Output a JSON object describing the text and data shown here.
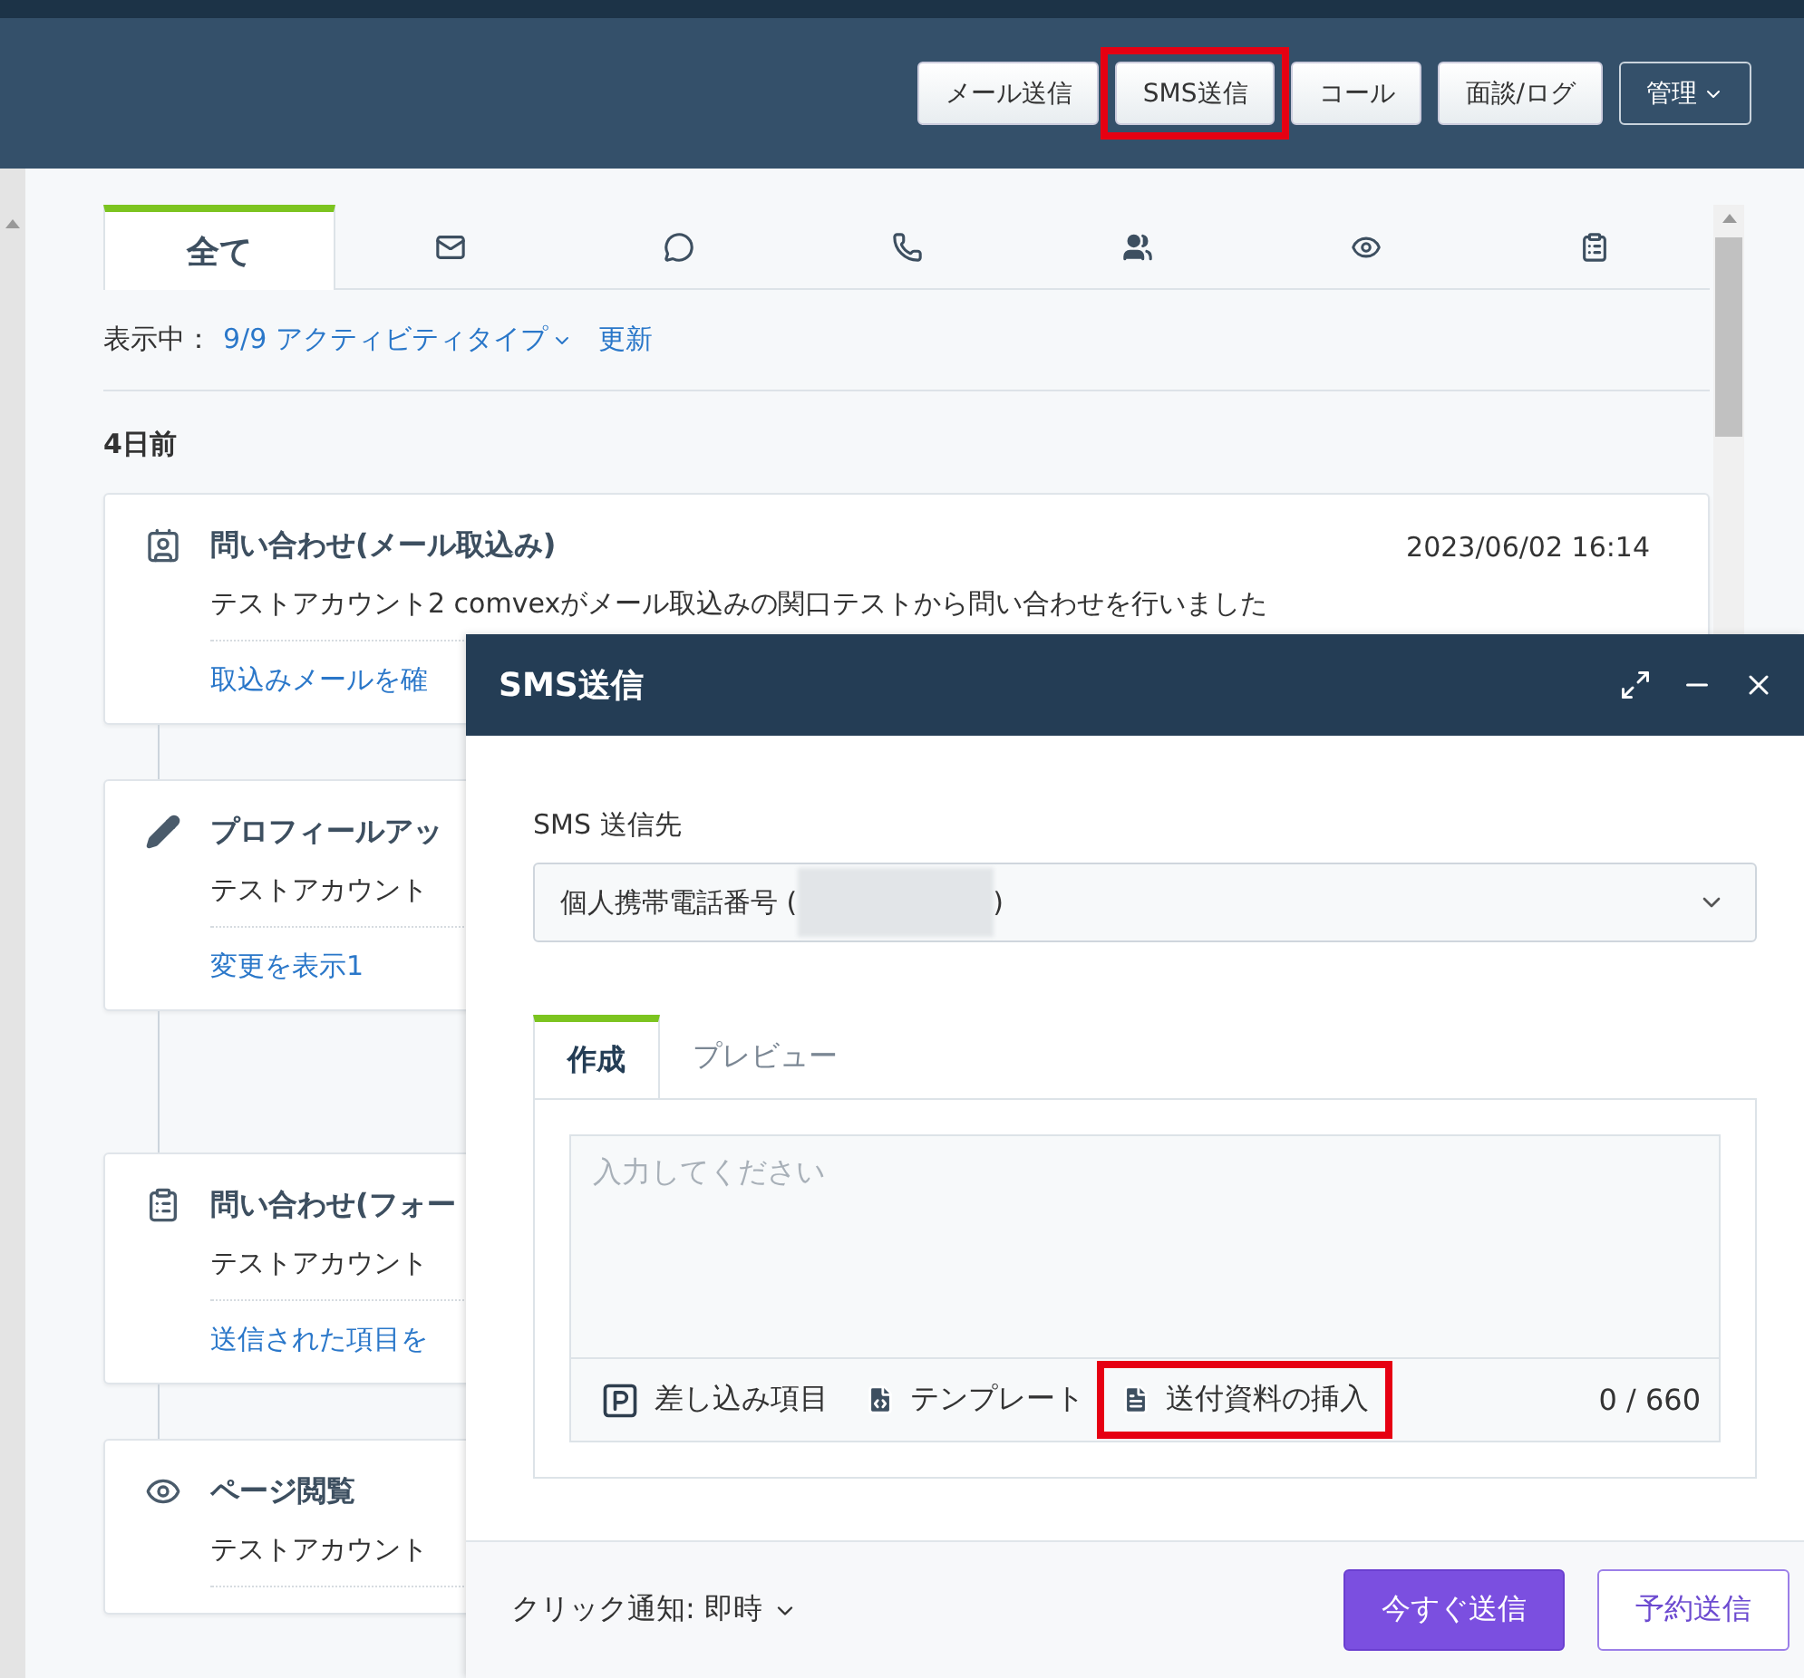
{
  "header": {
    "buttons": [
      {
        "label": "メール送信",
        "kind": "plain",
        "highlighted": false
      },
      {
        "label": "SMS送信",
        "kind": "plain",
        "highlighted": true
      },
      {
        "label": "コール",
        "kind": "plain",
        "highlighted": false
      },
      {
        "label": "面談/ログ",
        "kind": "plain",
        "highlighted": false
      },
      {
        "label": "管理",
        "kind": "menu",
        "highlighted": false
      }
    ]
  },
  "activity": {
    "tabs": [
      {
        "label": "全て",
        "selected": true
      },
      {
        "selected": false
      },
      {
        "selected": false
      },
      {
        "selected": false
      },
      {
        "selected": false
      },
      {
        "selected": false
      },
      {
        "selected": false
      }
    ],
    "filter": {
      "label": "表示中：",
      "value": "9/9 アクティビティタイプ",
      "refresh": "更新"
    },
    "group": "4日前",
    "cards": [
      {
        "title": "問い合わせ(メール取込み)",
        "date": "2023/06/02 16:14",
        "body": "テストアカウント2 comvexがメール取込みの関口テストから問い合わせを行いました",
        "link": "取込みメールを確"
      },
      {
        "title": "プロフィールアッ",
        "body": "テストアカウント",
        "link": "変更を表示1"
      },
      {
        "title": "問い合わせ(フォー",
        "body": "テストアカウント",
        "link": "送信された項目を"
      },
      {
        "title": "ページ閲覧",
        "body": "テストアカウント"
      }
    ]
  },
  "dialog": {
    "title": "SMS送信",
    "recipient_label": "SMS 送信先",
    "recipient_prefix": "個人携帯電話番号 (",
    "recipient_suffix": ")",
    "tabs": [
      {
        "label": "作成",
        "selected": true
      },
      {
        "label": "プレビュー",
        "selected": false
      }
    ],
    "placeholder": "入力してください",
    "tools": [
      {
        "label": "差し込み項目",
        "highlighted": false
      },
      {
        "label": "テンプレート",
        "highlighted": false
      },
      {
        "label": "送付資料の挿入",
        "highlighted": true
      }
    ],
    "counter": "0 / 660",
    "notify": "クリック通知: 即時",
    "buttons": [
      {
        "label": "今すぐ送信",
        "kind": "primary"
      },
      {
        "label": "予約送信",
        "kind": "secondary"
      }
    ]
  }
}
